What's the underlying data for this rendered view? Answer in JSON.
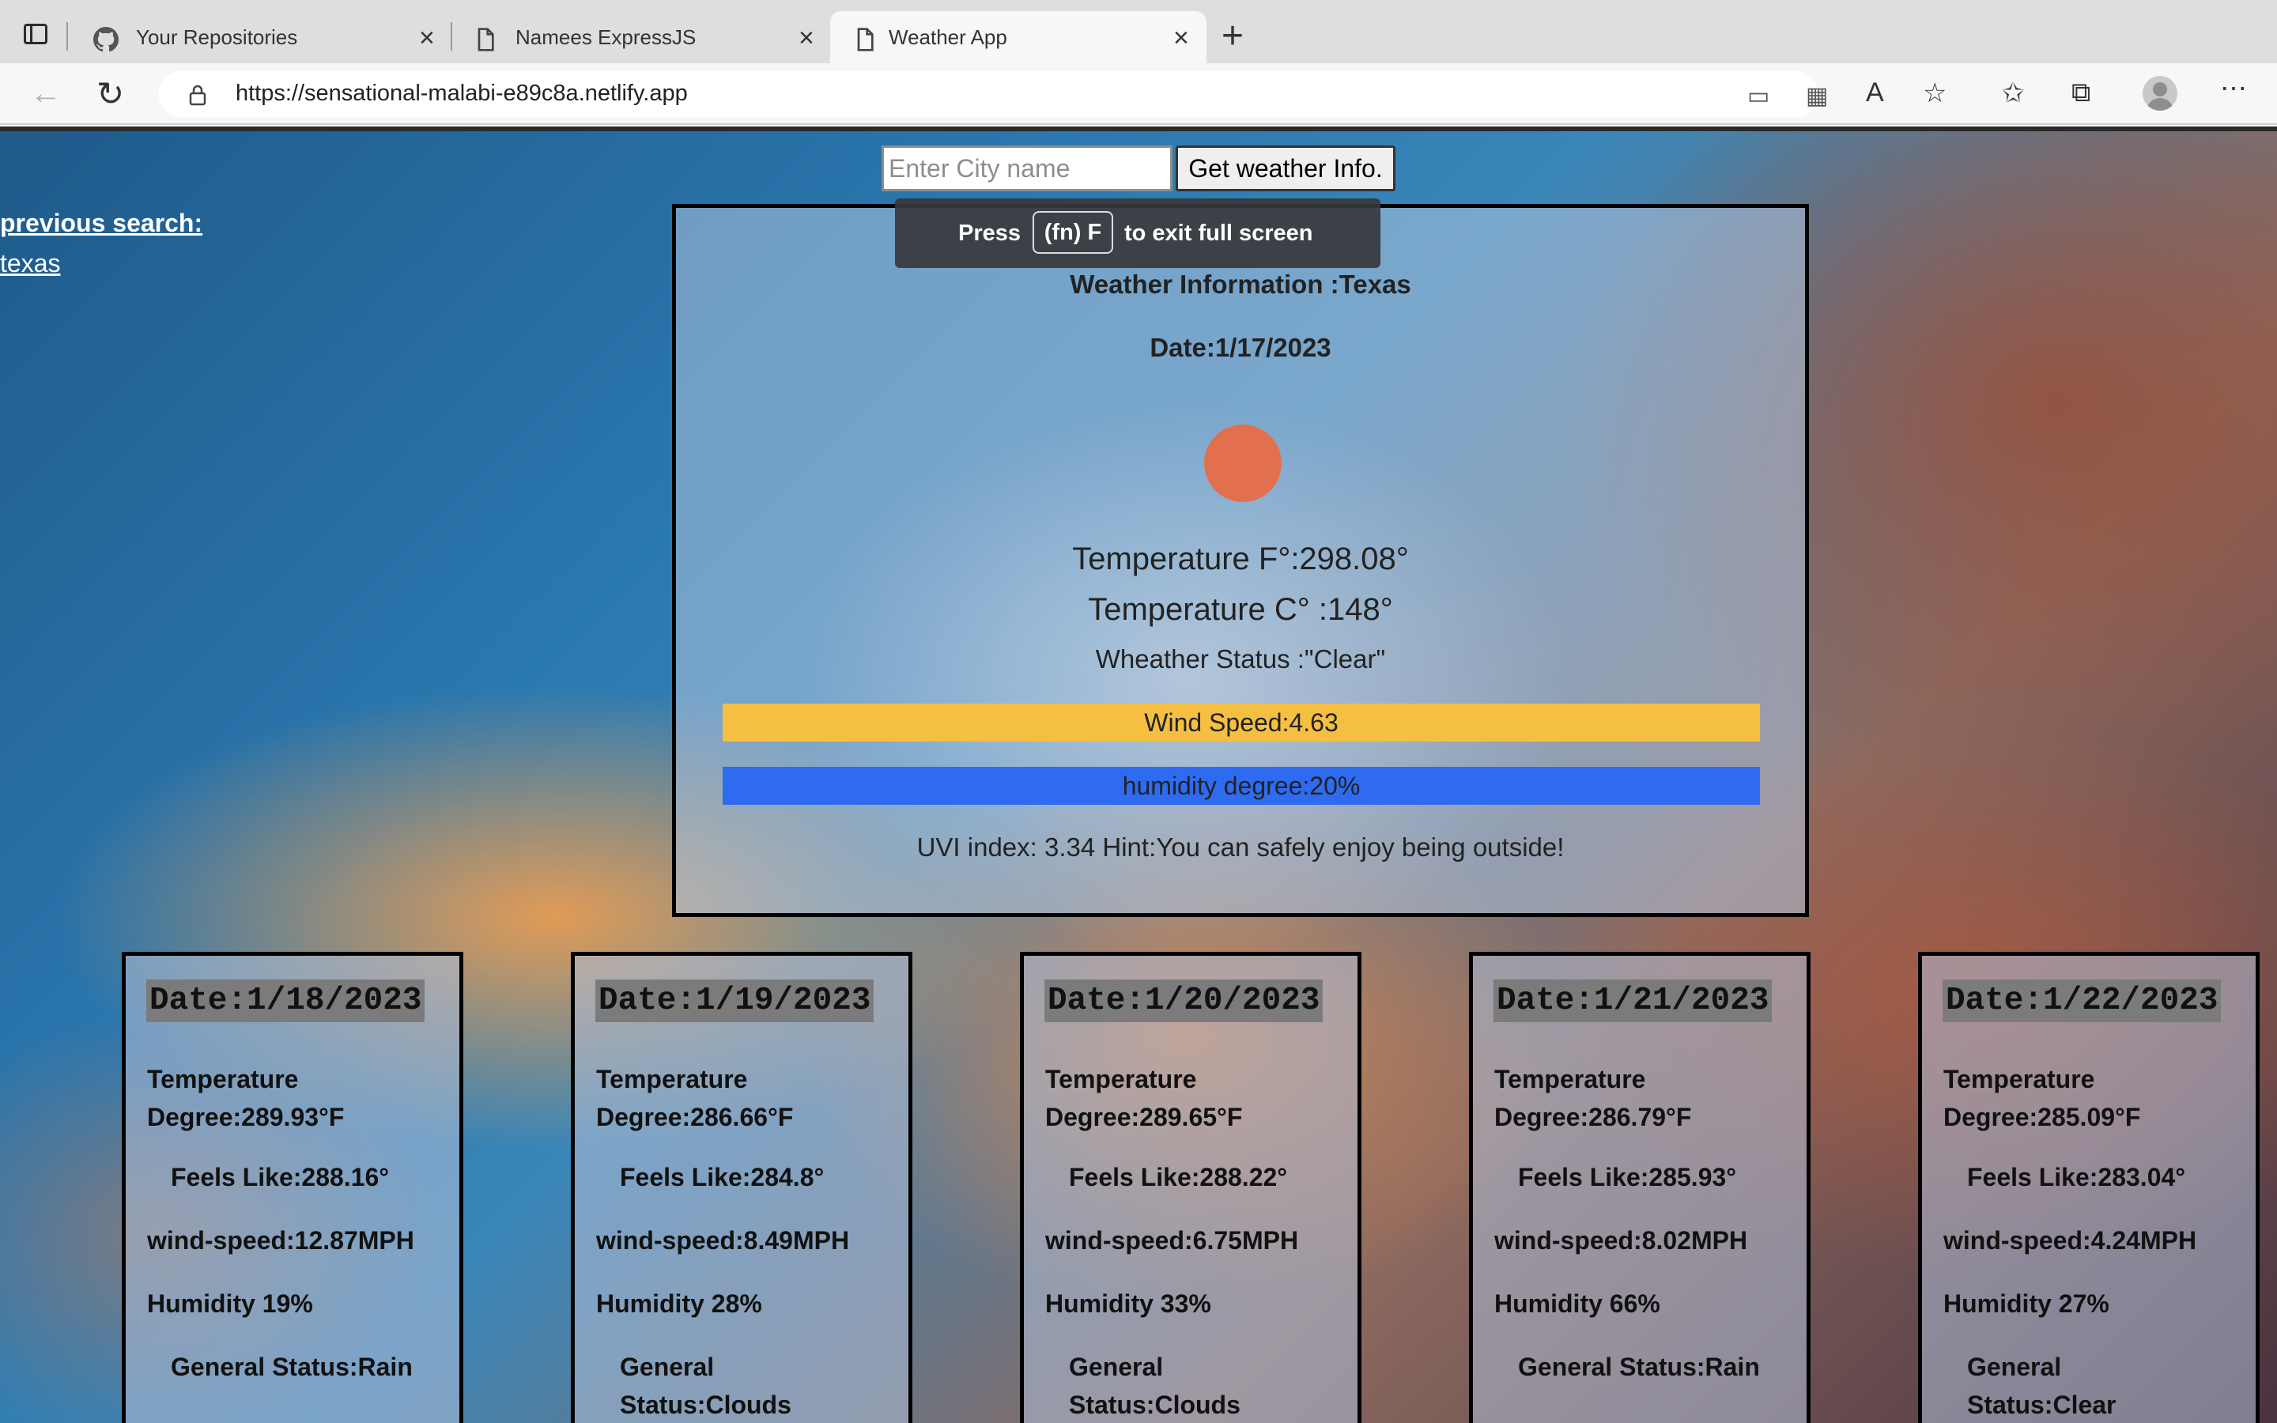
{
  "browser": {
    "tabs": [
      {
        "title": "Your Repositories",
        "icon": "github-icon",
        "active": false
      },
      {
        "title": "Namees ExpressJS",
        "icon": "page-icon",
        "active": false
      },
      {
        "title": "Weather App",
        "icon": "page-icon",
        "active": true
      }
    ],
    "url": "https://sensational-malabi-e89c8a.netlify.app"
  },
  "search": {
    "placeholder": "Enter City name",
    "button_label": "Get weather Info."
  },
  "previous_search": {
    "title": "previous search:",
    "items": [
      "texas"
    ]
  },
  "fullscreen_toast": {
    "press": "Press",
    "key": "(fn) F",
    "message": "to exit full screen"
  },
  "current": {
    "title": "Weather Information :Texas",
    "date": "Date:1/17/2023",
    "icon": "sun-icon",
    "temp_f": "Temperature F°:298.08°",
    "temp_c": "Temperature C° :148°",
    "status": "Wheather Status :\"Clear\"",
    "wind": "Wind Speed:4.63",
    "humidity": "humidity degree:20%",
    "uvi": "UVI index: 3.34 Hint:You can safely enjoy being outside!"
  },
  "forecast": [
    {
      "date": "Date:1/18/2023",
      "temp": "Temperature Degree:289.93°F",
      "feels": "Feels Like:288.16°",
      "wind": "wind-speed:12.87MPH",
      "humidity": "Humidity 19%",
      "status": "General Status:Rain"
    },
    {
      "date": "Date:1/19/2023",
      "temp": "Temperature Degree:286.66°F",
      "feels": "Feels Like:284.8°",
      "wind": "wind-speed:8.49MPH",
      "humidity": "Humidity 28%",
      "status": "General Status:Clouds"
    },
    {
      "date": "Date:1/20/2023",
      "temp": "Temperature Degree:289.65°F",
      "feels": "Feels Like:288.22°",
      "wind": "wind-speed:6.75MPH",
      "humidity": "Humidity 33%",
      "status": "General Status:Clouds"
    },
    {
      "date": "Date:1/21/2023",
      "temp": "Temperature Degree:286.79°F",
      "feels": "Feels Like:285.93°",
      "wind": "wind-speed:8.02MPH",
      "humidity": "Humidity 66%",
      "status": "General Status:Rain"
    },
    {
      "date": "Date:1/22/2023",
      "temp": "Temperature Degree:285.09°F",
      "feels": "Feels Like:283.04°",
      "wind": "wind-speed:4.24MPH",
      "humidity": "Humidity 27%",
      "status": "General Status:Clear"
    }
  ],
  "colors": {
    "wind_bar": "#f5bf42",
    "humidity_bar": "#2f6bf0",
    "sun": "#e2704e"
  }
}
